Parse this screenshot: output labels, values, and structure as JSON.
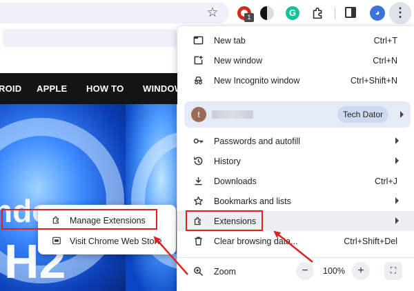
{
  "toolbar": {
    "extension_badge": "1",
    "grammarly_letter": "G",
    "icons": [
      "star-icon",
      "adblock-icon",
      "droplet-icon",
      "grammarly-icon",
      "puzzle-icon",
      "side-panel-icon",
      "profile-avatar-icon",
      "more-menu-icon"
    ]
  },
  "site_nav": {
    "items": [
      "ROID",
      "APPLE",
      "HOW TO",
      "WINDOW"
    ]
  },
  "hero": {
    "big_text_1": "ndows",
    "big_text_2": "H2"
  },
  "chrome_menu": {
    "items": [
      {
        "label": "New tab",
        "shortcut": "Ctrl+T",
        "icon": "new-tab-icon"
      },
      {
        "label": "New window",
        "shortcut": "Ctrl+N",
        "icon": "new-window-icon"
      },
      {
        "label": "New Incognito window",
        "shortcut": "Ctrl+Shift+N",
        "icon": "incognito-icon"
      }
    ],
    "profile": {
      "initial": "t",
      "chip": "Tech Dator"
    },
    "items2": [
      {
        "label": "Passwords and autofill",
        "icon": "key-icon"
      },
      {
        "label": "History",
        "icon": "history-icon"
      },
      {
        "label": "Downloads",
        "shortcut": "Ctrl+J",
        "icon": "download-icon"
      },
      {
        "label": "Bookmarks and lists",
        "icon": "star-icon"
      },
      {
        "label": "Extensions",
        "icon": "puzzle-icon"
      },
      {
        "label": "Clear browsing data...",
        "shortcut": "Ctrl+Shift+Del",
        "icon": "trash-icon"
      }
    ],
    "zoom": {
      "label": "Zoom",
      "minus": "−",
      "value": "100%",
      "plus": "+"
    }
  },
  "extensions_submenu": {
    "items": [
      {
        "label": "Manage Extensions",
        "icon": "puzzle-icon"
      },
      {
        "label": "Visit Chrome Web Store",
        "icon": "web-store-icon"
      }
    ]
  },
  "colors": {
    "highlight": "#e02020",
    "menu_bg": "#ffffff",
    "profile_bg": "#e4ebf7",
    "site_nav_bg": "#141414",
    "hero_blue": "#0a4fd9"
  }
}
